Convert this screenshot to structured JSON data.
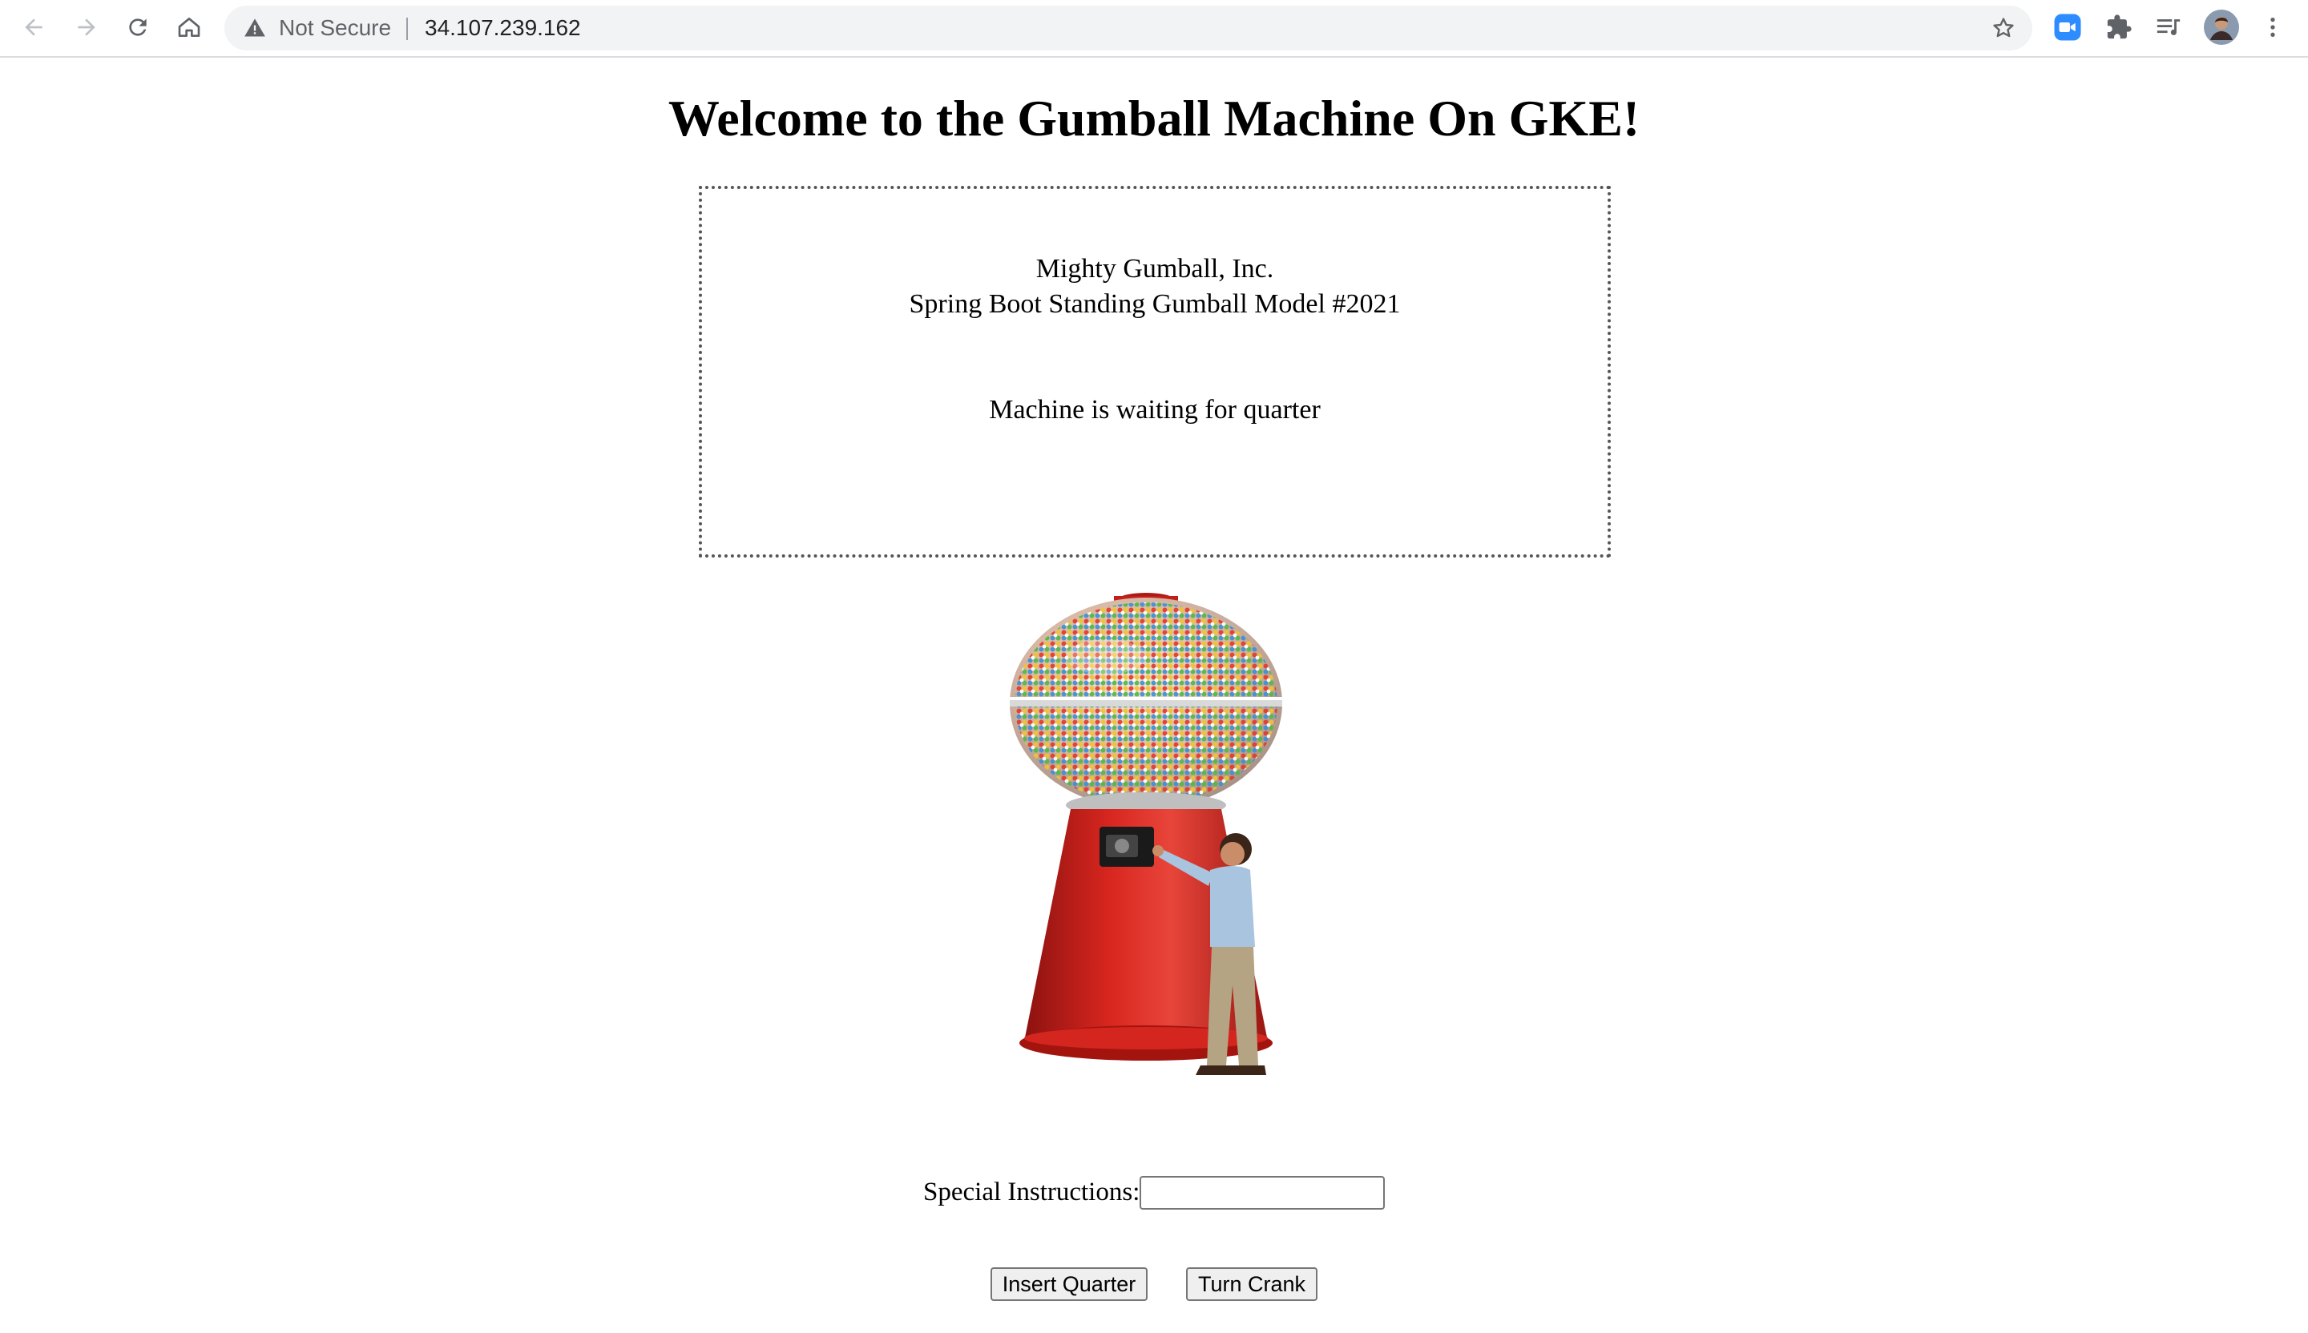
{
  "browser": {
    "security_label": "Not Secure",
    "url": "34.107.239.162",
    "icons": [
      "back-icon",
      "forward-icon",
      "reload-icon",
      "home-icon",
      "warning-icon",
      "star-icon",
      "zoom-extension-icon",
      "puzzle-icon",
      "media-queue-icon",
      "profile-avatar",
      "kebab-menu-icon"
    ]
  },
  "page": {
    "title": "Welcome to the Gumball Machine On GKE!",
    "box": {
      "company": "Mighty Gumball, Inc.",
      "model": "Spring Boot Standing Gumball Model #2021",
      "status": "Machine is waiting for quarter"
    },
    "form": {
      "instructions_label": "Special Instructions:",
      "instructions_value": "",
      "insert_label": "Insert Quarter",
      "crank_label": "Turn Crank"
    }
  },
  "colors": {
    "machine_red": "#c8201c",
    "chrome_bg": "#f1f3f4",
    "zoom_blue": "#2d8cff"
  }
}
